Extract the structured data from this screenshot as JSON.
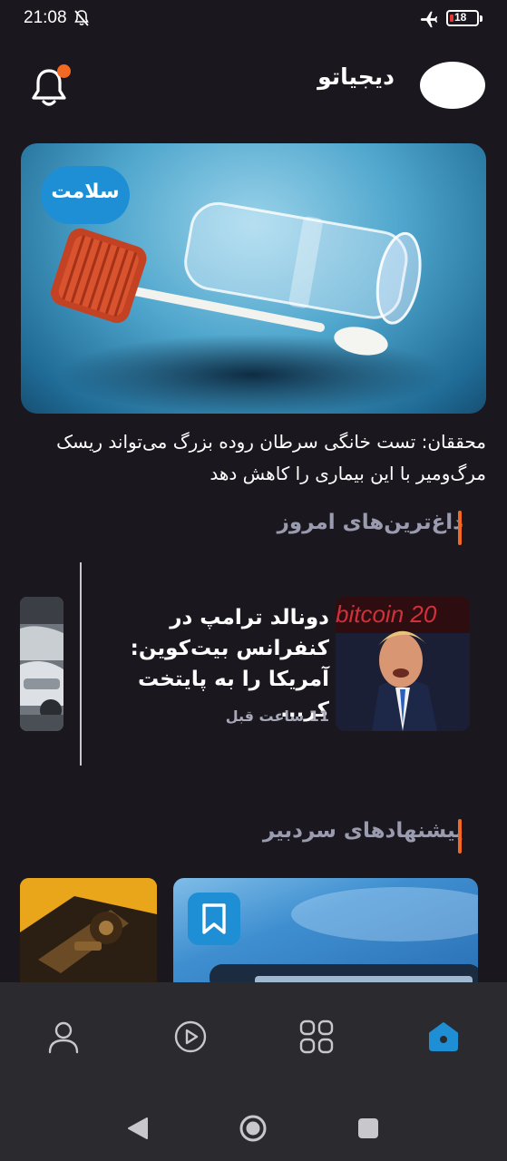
{
  "status_bar": {
    "time": "21:08",
    "battery_level": "18",
    "icons": [
      "mute-icon",
      "airplane-icon",
      "battery-icon"
    ]
  },
  "header": {
    "brand": "دیجیاتو",
    "has_notification": true
  },
  "hero": {
    "category": "سلامت",
    "title": "محققان: تست خانگی سرطان روده بزرگ می‌تواند ریسک مرگ‌ومیر با این بیماری را کاهش دهد"
  },
  "trending": {
    "heading": "داغ‌ترین‌های امروز",
    "card": {
      "title": "دونالد ترامپ در کنفرانس بیت‌کوین: آمریکا را به پایتخت کر...",
      "time": "11 ساعت قبل",
      "image_text": "bitcoin 20"
    }
  },
  "editor_picks": {
    "heading": "پیشنهادهای سردبیر"
  },
  "bottom_nav": {
    "items": [
      "profile-icon",
      "video-icon",
      "categories-icon",
      "home-icon"
    ],
    "active": "home-icon"
  },
  "colors": {
    "background": "#1a181e",
    "accent": "#f26a21",
    "brand_blue": "#1e8fd5",
    "nav_bg": "#2a2a2f"
  }
}
